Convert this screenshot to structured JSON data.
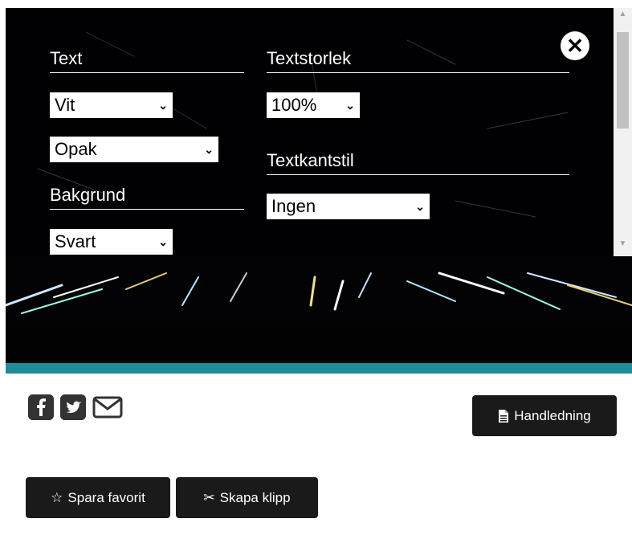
{
  "captions": {
    "text_heading": "Text",
    "text_color": "Vit",
    "text_opacity": "Opak",
    "background_heading": "Bakgrund",
    "background_color": "Svart",
    "text_size_heading": "Textstorlek",
    "text_size": "100%",
    "edge_style_heading": "Textkantstil",
    "edge_style": "Ingen",
    "close_glyph": "✕"
  },
  "actions": {
    "guide_label": "Handledning",
    "favorite_label": "Spara favorit",
    "clip_label": "Skapa klipp"
  },
  "social_icons": [
    "facebook-icon",
    "twitter-icon",
    "mail-icon"
  ],
  "colors": {
    "accent": "#1f8c9a",
    "button_bg": "#1a1a1a"
  }
}
